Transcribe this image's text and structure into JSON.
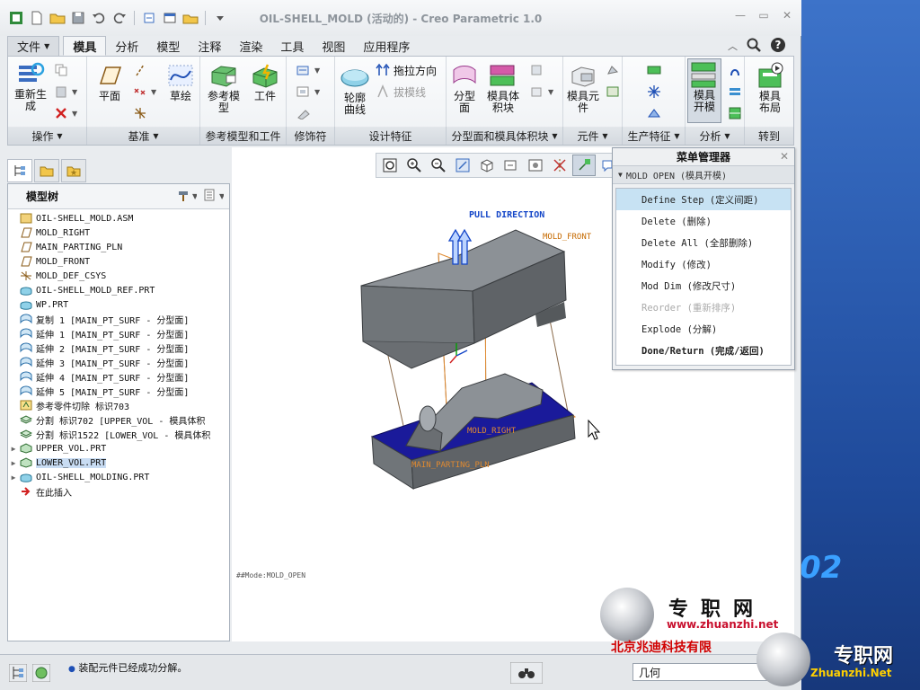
{
  "window": {
    "title": "OIL-SHELL_MOLD (活动的) - Creo Parametric 1.0"
  },
  "tabs": [
    "文件",
    "模具",
    "分析",
    "模型",
    "注释",
    "渲染",
    "工具",
    "视图",
    "应用程序"
  ],
  "ribbon": {
    "groups": [
      "操作",
      "基准",
      "参考模型和工件",
      "修饰符",
      "设计特征",
      "分型面和模具体积块",
      "元件",
      "生产特征",
      "分析",
      "转到"
    ],
    "regenerate": "重新生成",
    "plane": "平面",
    "sketch": "草绘",
    "ref_model": "参考模型",
    "workpiece": "工件",
    "contour_curve": "轮廓曲线",
    "drag_direction": "拖拉方向",
    "draft_line": "拔模线",
    "parting_surface": "分型面",
    "mold_volume": "模具体积块",
    "mold_component": "模具元件",
    "mold_opening": "模具开模",
    "mold_layout": "模具布局"
  },
  "left_panel": {
    "title": "模型树",
    "tree": [
      {
        "label": "OIL-SHELL_MOLD.ASM",
        "icon": "assembly-icon",
        "expand": ""
      },
      {
        "label": "MOLD_RIGHT",
        "icon": "datum-plane-icon",
        "expand": ""
      },
      {
        "label": "MAIN_PARTING_PLN",
        "icon": "datum-plane-icon",
        "expand": ""
      },
      {
        "label": "MOLD_FRONT",
        "icon": "datum-plane-icon",
        "expand": ""
      },
      {
        "label": "MOLD_DEF_CSYS",
        "icon": "csys-icon",
        "expand": ""
      },
      {
        "label": "OIL-SHELL_MOLD_REF.PRT",
        "icon": "part-icon",
        "expand": ""
      },
      {
        "label": "WP.PRT",
        "icon": "part-icon",
        "expand": ""
      },
      {
        "label": "复制 1 [MAIN_PT_SURF - 分型面]",
        "icon": "surface-icon",
        "expand": ""
      },
      {
        "label": "延伸 1 [MAIN_PT_SURF - 分型面]",
        "icon": "surface-icon",
        "expand": ""
      },
      {
        "label": "延伸 2 [MAIN_PT_SURF - 分型面]",
        "icon": "surface-icon",
        "expand": ""
      },
      {
        "label": "延伸 3 [MAIN_PT_SURF - 分型面]",
        "icon": "surface-icon",
        "expand": ""
      },
      {
        "label": "延伸 4 [MAIN_PT_SURF - 分型面]",
        "icon": "surface-icon",
        "expand": ""
      },
      {
        "label": "延伸 5 [MAIN_PT_SURF - 分型面]",
        "icon": "surface-icon",
        "expand": ""
      },
      {
        "label": "参考零件切除 标识703",
        "icon": "cut-icon",
        "expand": ""
      },
      {
        "label": "分割 标识702 [UPPER_VOL - 模具体积",
        "icon": "split-icon",
        "expand": ""
      },
      {
        "label": "分割 标识1522 [LOWER_VOL - 模具体积",
        "icon": "split-icon",
        "expand": ""
      },
      {
        "label": "UPPER_VOL.PRT",
        "icon": "volume-icon",
        "expand": "▶"
      },
      {
        "label": "LOWER_VOL.PRT",
        "icon": "volume-icon",
        "expand": "▶",
        "selected": true
      },
      {
        "label": "OIL-SHELL_MOLDING.PRT",
        "icon": "part-icon",
        "expand": "▶"
      },
      {
        "label": "在此插入",
        "icon": "insert-arrow-icon",
        "expand": ""
      }
    ]
  },
  "graphics": {
    "pull_direction": "PULL DIRECTION",
    "mold_front": "MOLD_FRONT",
    "status": "##Mode:MOLD_OPEN"
  },
  "menu_manager": {
    "title": "菜单管理器",
    "subtitle": "MOLD OPEN (模具开模)",
    "items": [
      {
        "label": "Define Step (定义间距)",
        "state": "highlighted"
      },
      {
        "label": "Delete (删除)",
        "state": "normal"
      },
      {
        "label": "Delete All (全部删除)",
        "state": "normal"
      },
      {
        "label": "Modify (修改)",
        "state": "normal"
      },
      {
        "label": "Mod Dim (修改尺寸)",
        "state": "normal"
      },
      {
        "label": "Reorder (重新排序)",
        "state": "disabled"
      },
      {
        "label": "Explode (分解)",
        "state": "normal"
      },
      {
        "label": "Done/Return (完成/返回)",
        "state": "bold"
      }
    ]
  },
  "status_bar": {
    "message": "装配元件已经成功分解。",
    "filter": "几何"
  },
  "watermark": {
    "site_name": "专职网",
    "url": "www.zhuanzhi.net",
    "company": "北京兆迪科技有限",
    "site_name2": "专职网",
    "url2": "Zhuanzhi.Net",
    "desktop_number": "02"
  }
}
